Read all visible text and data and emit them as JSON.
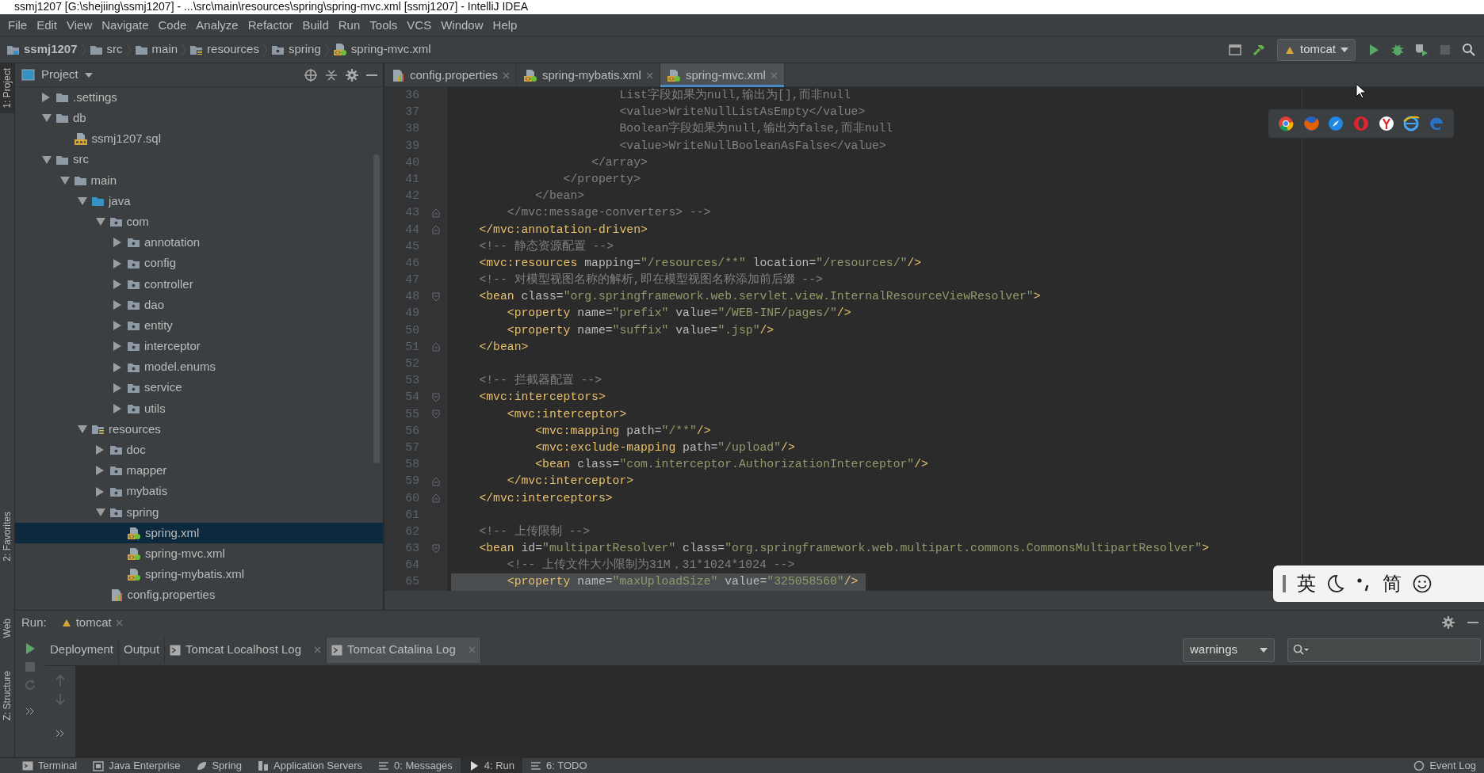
{
  "window": {
    "title": "ssmj1207 [G:\\shejiing\\ssmj1207] - ...\\src\\main\\resources\\spring\\spring-mvc.xml [ssmj1207] - IntelliJ IDEA"
  },
  "menu": [
    "File",
    "Edit",
    "View",
    "Navigate",
    "Code",
    "Analyze",
    "Refactor",
    "Build",
    "Run",
    "Tools",
    "VCS",
    "Window",
    "Help"
  ],
  "breadcrumb": [
    {
      "label": "ssmj1207",
      "kind": "module"
    },
    {
      "label": "src",
      "kind": "folder"
    },
    {
      "label": "main",
      "kind": "folder"
    },
    {
      "label": "resources",
      "kind": "resource-folder"
    },
    {
      "label": "spring",
      "kind": "package"
    },
    {
      "label": "spring-mvc.xml",
      "kind": "xml-file"
    }
  ],
  "run_config": {
    "label": "tomcat"
  },
  "side_stripe": {
    "top": [
      {
        "label": "1: Project",
        "selected": true
      }
    ],
    "bottom": [
      {
        "label": "2: Favorites",
        "selected": false
      },
      {
        "label": "Web",
        "selected": false
      },
      {
        "label": "Z: Structure",
        "selected": false
      }
    ]
  },
  "project": {
    "title": "Project",
    "tree": [
      {
        "label": ".settings",
        "kind": "folder",
        "expanded": false,
        "selected": false
      },
      {
        "label": "db",
        "kind": "folder",
        "expanded": true,
        "selected": false,
        "children": [
          {
            "label": "ssmj1207.sql",
            "kind": "sql-file",
            "selected": false
          }
        ]
      },
      {
        "label": "src",
        "kind": "folder",
        "expanded": true,
        "selected": false,
        "children": [
          {
            "label": "main",
            "kind": "folder",
            "expanded": true,
            "selected": false,
            "children": [
              {
                "label": "java",
                "kind": "source-folder",
                "expanded": true,
                "selected": false,
                "children": [
                  {
                    "label": "com",
                    "kind": "package",
                    "expanded": true,
                    "selected": false,
                    "children": [
                      {
                        "label": "annotation",
                        "kind": "package",
                        "expanded": false,
                        "selected": false
                      },
                      {
                        "label": "config",
                        "kind": "package",
                        "expanded": false,
                        "selected": false
                      },
                      {
                        "label": "controller",
                        "kind": "package",
                        "expanded": false,
                        "selected": false
                      },
                      {
                        "label": "dao",
                        "kind": "package",
                        "expanded": false,
                        "selected": false
                      },
                      {
                        "label": "entity",
                        "kind": "package",
                        "expanded": false,
                        "selected": false
                      },
                      {
                        "label": "interceptor",
                        "kind": "package",
                        "expanded": false,
                        "selected": false
                      },
                      {
                        "label": "model.enums",
                        "kind": "package",
                        "expanded": false,
                        "selected": false
                      },
                      {
                        "label": "service",
                        "kind": "package",
                        "expanded": false,
                        "selected": false
                      },
                      {
                        "label": "utils",
                        "kind": "package",
                        "expanded": false,
                        "selected": false
                      }
                    ]
                  }
                ]
              },
              {
                "label": "resources",
                "kind": "resource-folder",
                "expanded": true,
                "selected": false,
                "children": [
                  {
                    "label": "doc",
                    "kind": "package",
                    "expanded": false,
                    "selected": false
                  },
                  {
                    "label": "mapper",
                    "kind": "package",
                    "expanded": false,
                    "selected": false
                  },
                  {
                    "label": "mybatis",
                    "kind": "package",
                    "expanded": false,
                    "selected": false
                  },
                  {
                    "label": "spring",
                    "kind": "package",
                    "expanded": true,
                    "selected": false,
                    "children": [
                      {
                        "label": "spring.xml",
                        "kind": "xml-file",
                        "selected": true
                      },
                      {
                        "label": "spring-mvc.xml",
                        "kind": "xml-file",
                        "selected": false
                      },
                      {
                        "label": "spring-mybatis.xml",
                        "kind": "xml-file",
                        "selected": false
                      }
                    ]
                  },
                  {
                    "label": "config.properties",
                    "kind": "properties-file",
                    "selected": false
                  }
                ]
              }
            ]
          }
        ]
      }
    ]
  },
  "editor": {
    "tabs": [
      {
        "label": "config.properties",
        "kind": "properties-file",
        "selected": false
      },
      {
        "label": "spring-mybatis.xml",
        "kind": "xml-file",
        "selected": false
      },
      {
        "label": "spring-mvc.xml",
        "kind": "xml-file",
        "selected": true
      }
    ],
    "lines": [
      {
        "number": "36",
        "kind": "plain",
        "selected": false,
        "tokens": [
          {
            "kind": "comment",
            "text": "                        List字段如果为null,输出为[],而非null"
          }
        ]
      },
      {
        "number": "37",
        "kind": "plain",
        "selected": false,
        "tokens": [
          {
            "kind": "comment",
            "text": "                        <value>WriteNullListAsEmpty</value>"
          }
        ]
      },
      {
        "number": "38",
        "kind": "plain",
        "selected": false,
        "tokens": [
          {
            "kind": "comment",
            "text": "                        Boolean字段如果为null,输出为false,而非null"
          }
        ]
      },
      {
        "number": "39",
        "kind": "plain",
        "selected": false,
        "tokens": [
          {
            "kind": "comment",
            "text": "                        <value>WriteNullBooleanAsFalse</value>"
          }
        ]
      },
      {
        "number": "40",
        "kind": "plain",
        "selected": false,
        "tokens": [
          {
            "kind": "comment",
            "text": "                    </array>"
          }
        ]
      },
      {
        "number": "41",
        "kind": "plain",
        "selected": false,
        "tokens": [
          {
            "kind": "comment",
            "text": "                </property>"
          }
        ]
      },
      {
        "number": "42",
        "kind": "plain",
        "selected": false,
        "tokens": [
          {
            "kind": "comment",
            "text": "            </bean>"
          }
        ]
      },
      {
        "number": "43",
        "kind": "fold-end",
        "selected": false,
        "tokens": [
          {
            "kind": "comment",
            "text": "        </mvc:message-converters> -->"
          }
        ]
      },
      {
        "number": "44",
        "kind": "fold-end",
        "selected": false,
        "tokens": [
          {
            "kind": "tag",
            "text": "    </mvc:annotation-driven>"
          }
        ]
      },
      {
        "number": "45",
        "kind": "plain",
        "selected": false,
        "tokens": [
          {
            "kind": "comment",
            "text": "    <!-- 静态资源配置 -->"
          }
        ]
      },
      {
        "number": "46",
        "kind": "plain",
        "selected": false,
        "tokens": [
          {
            "kind": "tag",
            "text": "    <mvc:resources"
          },
          {
            "kind": "attr",
            "text": " mapping="
          },
          {
            "kind": "value",
            "text": "\"/resources/**\""
          },
          {
            "kind": "attr",
            "text": " location="
          },
          {
            "kind": "value",
            "text": "\"/resources/\""
          },
          {
            "kind": "tag",
            "text": "/>"
          }
        ]
      },
      {
        "number": "47",
        "kind": "plain",
        "selected": false,
        "tokens": [
          {
            "kind": "comment",
            "text": "    <!-- 对模型视图名称的解析,即在模型视图名称添加前后缀 -->"
          }
        ]
      },
      {
        "number": "48",
        "kind": "fold-start",
        "selected": false,
        "tokens": [
          {
            "kind": "tag",
            "text": "    <bean"
          },
          {
            "kind": "attr",
            "text": " class="
          },
          {
            "kind": "value",
            "text": "\"org.springframework.web.servlet.view.InternalResourceViewResolver\""
          },
          {
            "kind": "tag",
            "text": ">"
          }
        ]
      },
      {
        "number": "49",
        "kind": "plain",
        "selected": false,
        "tokens": [
          {
            "kind": "tag",
            "text": "        <property"
          },
          {
            "kind": "attr",
            "text": " name="
          },
          {
            "kind": "value",
            "text": "\"prefix\""
          },
          {
            "kind": "attr",
            "text": " value="
          },
          {
            "kind": "value",
            "text": "\"/WEB-INF/pages/\""
          },
          {
            "kind": "tag",
            "text": "/>"
          }
        ]
      },
      {
        "number": "50",
        "kind": "plain",
        "selected": false,
        "tokens": [
          {
            "kind": "tag",
            "text": "        <property"
          },
          {
            "kind": "attr",
            "text": " name="
          },
          {
            "kind": "value",
            "text": "\"suffix\""
          },
          {
            "kind": "attr",
            "text": " value="
          },
          {
            "kind": "value",
            "text": "\".jsp\""
          },
          {
            "kind": "tag",
            "text": "/>"
          }
        ]
      },
      {
        "number": "51",
        "kind": "fold-end",
        "selected": false,
        "tokens": [
          {
            "kind": "tag",
            "text": "    </bean>"
          }
        ]
      },
      {
        "number": "52",
        "kind": "plain",
        "selected": false
      },
      {
        "number": "53",
        "kind": "plain",
        "selected": false,
        "tokens": [
          {
            "kind": "comment",
            "text": "    <!-- 拦截器配置 -->"
          }
        ]
      },
      {
        "number": "54",
        "kind": "fold-start",
        "selected": false,
        "tokens": [
          {
            "kind": "tag",
            "text": "    <mvc:interceptors>"
          }
        ]
      },
      {
        "number": "55",
        "kind": "fold-start",
        "selected": false,
        "tokens": [
          {
            "kind": "tag",
            "text": "        <mvc:interceptor>"
          }
        ]
      },
      {
        "number": "56",
        "kind": "plain",
        "selected": false,
        "tokens": [
          {
            "kind": "tag",
            "text": "            <mvc:mapping"
          },
          {
            "kind": "attr",
            "text": " path="
          },
          {
            "kind": "value",
            "text": "\"/**\""
          },
          {
            "kind": "tag",
            "text": "/>"
          }
        ]
      },
      {
        "number": "57",
        "kind": "plain",
        "selected": false,
        "tokens": [
          {
            "kind": "tag",
            "text": "            <mvc:exclude-mapping"
          },
          {
            "kind": "attr",
            "text": " path="
          },
          {
            "kind": "value",
            "text": "\"/upload\""
          },
          {
            "kind": "tag",
            "text": "/>"
          }
        ]
      },
      {
        "number": "58",
        "kind": "plain",
        "selected": false,
        "tokens": [
          {
            "kind": "tag",
            "text": "            <bean"
          },
          {
            "kind": "attr",
            "text": " class="
          },
          {
            "kind": "value",
            "text": "\"com.interceptor.AuthorizationInterceptor\""
          },
          {
            "kind": "tag",
            "text": "/>"
          }
        ]
      },
      {
        "number": "59",
        "kind": "fold-end",
        "selected": false,
        "tokens": [
          {
            "kind": "tag",
            "text": "        </mvc:interceptor>"
          }
        ]
      },
      {
        "number": "60",
        "kind": "fold-end",
        "selected": false,
        "tokens": [
          {
            "kind": "tag",
            "text": "    </mvc:interceptors>"
          }
        ]
      },
      {
        "number": "61",
        "kind": "plain",
        "selected": false
      },
      {
        "number": "62",
        "kind": "plain",
        "selected": false,
        "tokens": [
          {
            "kind": "comment",
            "text": "    <!-- 上传限制 -->"
          }
        ]
      },
      {
        "number": "63",
        "kind": "fold-start",
        "selected": false,
        "tokens": [
          {
            "kind": "tag",
            "text": "    <bean"
          },
          {
            "kind": "attr",
            "text": " id="
          },
          {
            "kind": "value",
            "text": "\"multipartResolver\""
          },
          {
            "kind": "attr",
            "text": " class="
          },
          {
            "kind": "value",
            "text": "\"org.springframework.web.multipart.commons.CommonsMultipartResolver\""
          },
          {
            "kind": "tag",
            "text": ">"
          }
        ]
      },
      {
        "number": "64",
        "kind": "plain",
        "selected": false,
        "tokens": [
          {
            "kind": "comment",
            "text": "        <!-- 上传文件大小限制为31M，31*1024*1024 -->"
          }
        ]
      },
      {
        "number": "65",
        "kind": "plain",
        "selected": true,
        "tokens": [
          {
            "kind": "tag",
            "text": "        <property"
          },
          {
            "kind": "attr",
            "text": " name="
          },
          {
            "kind": "value",
            "text": "\"maxUploadSize\""
          },
          {
            "kind": "attr",
            "text": " value="
          },
          {
            "kind": "value",
            "text": "\"325058560\""
          },
          {
            "kind": "tag",
            "text": "/>"
          }
        ]
      }
    ]
  },
  "ime_bar": {
    "mode": "英",
    "script": "简"
  },
  "run_panel": {
    "label": "Run:",
    "config_tab": {
      "label": "tomcat"
    },
    "tabs": [
      {
        "label": "Deployment",
        "closable": false,
        "selected": false
      },
      {
        "label": "Output",
        "closable": false,
        "selected": false
      },
      {
        "label": "Tomcat Localhost Log",
        "closable": true,
        "selected": false
      },
      {
        "label": "Tomcat Catalina Log",
        "closable": true,
        "selected": true
      }
    ],
    "filter": {
      "value": "warnings"
    }
  },
  "status_bar": {
    "tools": [
      {
        "label": "Terminal",
        "kind": "terminal",
        "selected": false
      },
      {
        "label": "Java Enterprise",
        "kind": "app",
        "selected": false
      },
      {
        "label": "Spring",
        "kind": "leaf",
        "selected": false
      },
      {
        "label": "Application Servers",
        "kind": "server",
        "selected": false
      },
      {
        "label": "0: Messages",
        "kind": "list",
        "selected": false
      },
      {
        "label": "4: Run",
        "kind": "play",
        "selected": true
      },
      {
        "label": "6: TODO",
        "kind": "list",
        "selected": false
      }
    ],
    "event_log": "Event Log"
  }
}
